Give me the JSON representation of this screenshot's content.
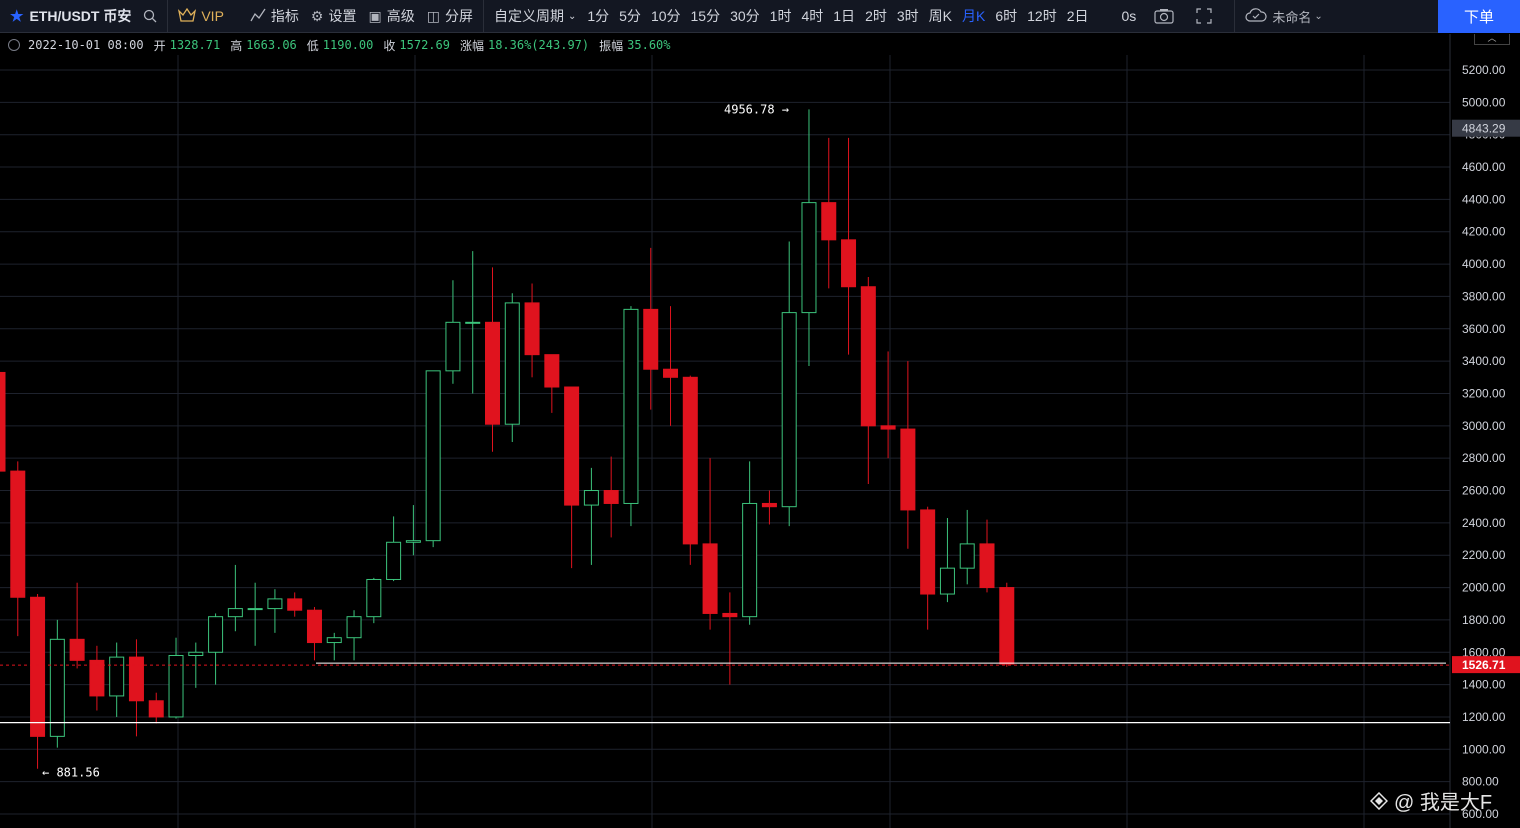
{
  "toolbar": {
    "symbol": "ETH/USDT 币安",
    "vip": "VIP",
    "indicators": "指标",
    "settings": "设置",
    "advanced": "高级",
    "split": "分屏",
    "custom_period": "自定义周期",
    "periods": [
      "1分",
      "5分",
      "10分",
      "15分",
      "30分",
      "1时",
      "4时",
      "1日",
      "2时",
      "3时",
      "周K",
      "月K",
      "6时",
      "12时",
      "2日"
    ],
    "active_period": "月K",
    "countdown": "0s",
    "layout_name": "未命名",
    "order_button": "下单"
  },
  "ohlc": {
    "date": "2022-10-01 08:00",
    "open_label": "开",
    "open": "1328.71",
    "high_label": "高",
    "high": "1663.06",
    "low_label": "低",
    "low": "1190.00",
    "close_label": "收",
    "close": "1572.69",
    "change_label": "涨幅",
    "change": "18.36%(243.97)",
    "amplitude_label": "振幅",
    "amplitude": "35.60%"
  },
  "watermark": "@ 我是大F",
  "colors": {
    "up": "#3cc47c",
    "down": "#e0131e",
    "grid": "#1e222d",
    "axis_text": "#d1d4dc"
  },
  "chart_data": {
    "type": "candlestick",
    "ylim": [
      600,
      5300
    ],
    "y_ticks": [
      600,
      800,
      1000,
      1200,
      1400,
      1600,
      1800,
      2000,
      2200,
      2400,
      2600,
      2800,
      3000,
      3200,
      3400,
      3600,
      3800,
      4000,
      4200,
      4400,
      4600,
      4800,
      5000,
      5200
    ],
    "y_tick_labels": [
      "600.00",
      "800.00",
      "1000.00",
      "1200.00",
      "1400.00",
      "1600.00",
      "1800.00",
      "2000.00",
      "2200.00",
      "2400.00",
      "2600.00",
      "2800.00",
      "3000.00",
      "3200.00",
      "3400.00",
      "3600.00",
      "3800.00",
      "4000.00",
      "4200.00",
      "4400.00",
      "4600.00",
      "4800.00",
      "5000.00",
      "5200.00"
    ],
    "candles": [
      {
        "o": 3330,
        "h": 3900,
        "l": 2710,
        "c": 2720
      },
      {
        "o": 2720,
        "h": 2780,
        "l": 1700,
        "c": 1940
      },
      {
        "o": 1940,
        "h": 1960,
        "l": 880,
        "c": 1080
      },
      {
        "o": 1080,
        "h": 1800,
        "l": 1010,
        "c": 1680
      },
      {
        "o": 1680,
        "h": 2030,
        "l": 1500,
        "c": 1550
      },
      {
        "o": 1550,
        "h": 1640,
        "l": 1240,
        "c": 1330
      },
      {
        "o": 1330,
        "h": 1660,
        "l": 1200,
        "c": 1570
      },
      {
        "o": 1570,
        "h": 1680,
        "l": 1080,
        "c": 1300
      },
      {
        "o": 1300,
        "h": 1350,
        "l": 1160,
        "c": 1200
      },
      {
        "o": 1200,
        "h": 1690,
        "l": 1190,
        "c": 1580
      },
      {
        "o": 1580,
        "h": 1660,
        "l": 1380,
        "c": 1600
      },
      {
        "o": 1600,
        "h": 1840,
        "l": 1400,
        "c": 1820
      },
      {
        "o": 1820,
        "h": 2140,
        "l": 1730,
        "c": 1870
      },
      {
        "o": 1870,
        "h": 2030,
        "l": 1640,
        "c": 1870
      },
      {
        "o": 1870,
        "h": 1990,
        "l": 1720,
        "c": 1930
      },
      {
        "o": 1930,
        "h": 1970,
        "l": 1820,
        "c": 1860
      },
      {
        "o": 1860,
        "h": 1880,
        "l": 1550,
        "c": 1660
      },
      {
        "o": 1660,
        "h": 1720,
        "l": 1550,
        "c": 1690
      },
      {
        "o": 1690,
        "h": 1860,
        "l": 1550,
        "c": 1820
      },
      {
        "o": 1820,
        "h": 2060,
        "l": 1780,
        "c": 2050
      },
      {
        "o": 2050,
        "h": 2440,
        "l": 2040,
        "c": 2280
      },
      {
        "o": 2280,
        "h": 2510,
        "l": 2200,
        "c": 2290
      },
      {
        "o": 2290,
        "h": 3330,
        "l": 2250,
        "c": 3340
      },
      {
        "o": 3340,
        "h": 3900,
        "l": 3260,
        "c": 3640
      },
      {
        "o": 3640,
        "h": 4080,
        "l": 3200,
        "c": 3640
      },
      {
        "o": 3640,
        "h": 3980,
        "l": 2840,
        "c": 3010
      },
      {
        "o": 3010,
        "h": 3820,
        "l": 2900,
        "c": 3760
      },
      {
        "o": 3760,
        "h": 3880,
        "l": 3300,
        "c": 3440
      },
      {
        "o": 3440,
        "h": 3440,
        "l": 3080,
        "c": 3240
      },
      {
        "o": 3240,
        "h": 3240,
        "l": 2120,
        "c": 2510
      },
      {
        "o": 2510,
        "h": 2740,
        "l": 2140,
        "c": 2600
      },
      {
        "o": 2600,
        "h": 2810,
        "l": 2310,
        "c": 2520
      },
      {
        "o": 2520,
        "h": 3740,
        "l": 2380,
        "c": 3720
      },
      {
        "o": 3720,
        "h": 4100,
        "l": 3100,
        "c": 3350
      },
      {
        "o": 3350,
        "h": 3740,
        "l": 3000,
        "c": 3300
      },
      {
        "o": 3300,
        "h": 3310,
        "l": 2140,
        "c": 2270
      },
      {
        "o": 2270,
        "h": 2800,
        "l": 1740,
        "c": 1840
      },
      {
        "o": 1840,
        "h": 1970,
        "l": 1400,
        "c": 1820
      },
      {
        "o": 1820,
        "h": 2780,
        "l": 1770,
        "c": 2520
      },
      {
        "o": 2520,
        "h": 2600,
        "l": 2390,
        "c": 2500
      },
      {
        "o": 2500,
        "h": 4140,
        "l": 2380,
        "c": 3700
      },
      {
        "o": 3700,
        "h": 4956.78,
        "l": 3370,
        "c": 4380
      },
      {
        "o": 4380,
        "h": 4780,
        "l": 3850,
        "c": 4150
      },
      {
        "o": 4150,
        "h": 4780,
        "l": 3440,
        "c": 3860
      },
      {
        "o": 3860,
        "h": 3920,
        "l": 2640,
        "c": 3000
      },
      {
        "o": 3000,
        "h": 3460,
        "l": 2800,
        "c": 2980
      },
      {
        "o": 2980,
        "h": 3400,
        "l": 2240,
        "c": 2480
      },
      {
        "o": 2480,
        "h": 2500,
        "l": 1740,
        "c": 1960
      },
      {
        "o": 1960,
        "h": 2430,
        "l": 1910,
        "c": 2120
      },
      {
        "o": 2120,
        "h": 2480,
        "l": 2020,
        "c": 2270
      },
      {
        "o": 2270,
        "h": 2420,
        "l": 1970,
        "c": 2000
      },
      {
        "o": 2000,
        "h": 2030,
        "l": 1510,
        "c": 1526.71
      }
    ],
    "high_marker": "4956.78",
    "low_marker": "881.56",
    "last_price": "1526.71",
    "last_price_value": 1526.71,
    "prev_price": "4843.29",
    "prev_price_value": 4843.29,
    "support_level": 1165
  }
}
